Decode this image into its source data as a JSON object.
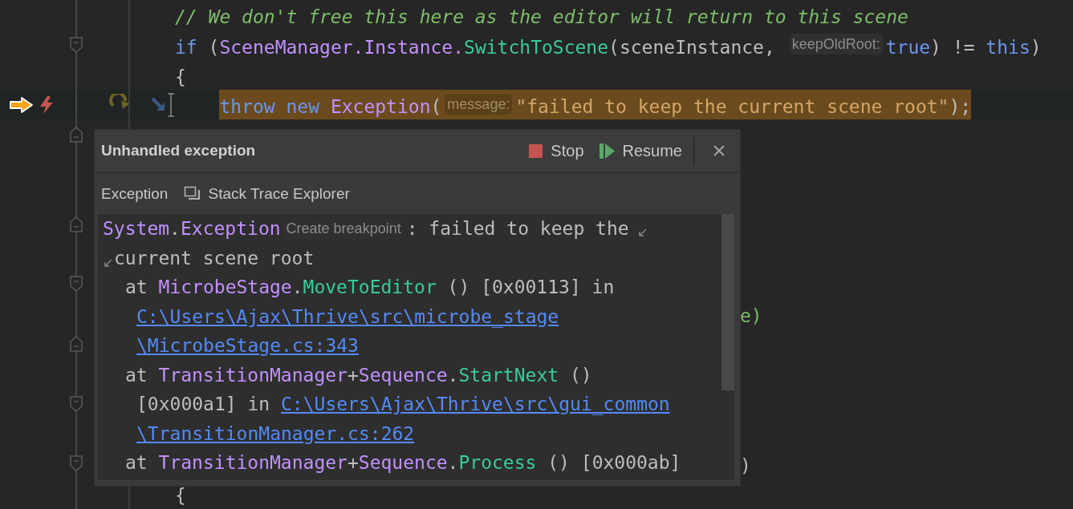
{
  "editor": {
    "lines": [
      {
        "kind": "plain",
        "tokens": [
          {
            "kind": "comment",
            "text": "// We don't free this here as the editor will return to this scene"
          }
        ]
      },
      {
        "kind": "fold-start",
        "tokens": [
          {
            "kind": "keyword",
            "text": "if"
          },
          {
            "kind": "plain",
            "text": " ("
          },
          {
            "kind": "type",
            "text": "SceneManager.Instance."
          },
          {
            "kind": "method",
            "text": "SwitchToScene"
          },
          {
            "kind": "plain",
            "text": "(sceneInstance, "
          },
          {
            "kind": "hint",
            "text": "keepOldRoot:"
          },
          {
            "kind": "keyword",
            "text": "true"
          },
          {
            "kind": "plain",
            "text": ") != "
          },
          {
            "kind": "keyword",
            "text": "this"
          },
          {
            "kind": "plain",
            "text": ")"
          }
        ]
      },
      {
        "kind": "plain",
        "tokens": [
          {
            "kind": "plain",
            "text": "{"
          }
        ],
        "children": [
          {
            "current": true,
            "tokens": [
              {
                "kind": "keyword",
                "text": "throw new "
              },
              {
                "kind": "type",
                "text": "Exception"
              },
              {
                "kind": "plain",
                "text": "("
              },
              {
                "kind": "hint",
                "text": "message:"
              },
              {
                "kind": "string",
                "text": "\"failed to keep the current scene root\""
              },
              {
                "kind": "plain",
                "text": ");"
              }
            ]
          }
        ]
      },
      {
        "kind": "fold-end"
      },
      {
        "kind": "plain"
      },
      {
        "kind": "plain"
      },
      {
        "kind": "fold-end"
      },
      {
        "kind": "plain"
      },
      {
        "kind": "fold-start"
      },
      {
        "kind": "plain",
        "tail": [
          {
            "kind": "tail",
            "text": "e)"
          }
        ]
      },
      {
        "kind": "fold-end"
      },
      {
        "kind": "plain"
      },
      {
        "kind": "fold-start"
      },
      {
        "kind": "plain"
      },
      {
        "kind": "fold-start",
        "tail": [
          {
            "kind": "plain",
            "text": ")"
          }
        ]
      },
      {
        "kind": "plain",
        "tokens": [
          {
            "kind": "plain",
            "text": "{"
          }
        ]
      }
    ]
  },
  "popup": {
    "title": "Unhandled exception",
    "actions": [
      {
        "kind": "stop",
        "label": "Stop"
      },
      {
        "kind": "resume",
        "label": "Resume"
      }
    ],
    "tabs": [
      {
        "kind": "plain",
        "label": "Exception"
      },
      {
        "kind": "explorer",
        "label": "Stack Trace Explorer"
      }
    ],
    "trace": [
      {
        "kind": "message",
        "tokens": [
          {
            "kind": "type",
            "text": "System"
          },
          {
            "kind": "plain",
            "text": "."
          },
          {
            "kind": "type",
            "text": "Exception"
          },
          {
            "kind": "hint",
            "text": "Create breakpoint"
          },
          {
            "kind": "plain",
            "text": ": failed to keep the"
          }
        ]
      },
      {
        "kind": "wrapped",
        "tokens": [
          {
            "kind": "plain",
            "text": "current scene root"
          }
        ]
      },
      {
        "kind": "frame",
        "tokens": [
          {
            "kind": "plain",
            "text": "at "
          },
          {
            "kind": "type",
            "text": "MicrobeStage"
          },
          {
            "kind": "plain",
            "text": "."
          },
          {
            "kind": "method",
            "text": "MoveToEditor"
          },
          {
            "kind": "plain",
            "text": " () [0x00113] in"
          }
        ]
      },
      {
        "kind": "continuation",
        "tokens": [
          {
            "kind": "link",
            "text": "C:\\Users\\Ajax\\Thrive\\src\\microbe_stage"
          }
        ]
      },
      {
        "kind": "continuation",
        "tokens": [
          {
            "kind": "link",
            "text": "\\MicrobeStage.cs:343"
          }
        ]
      },
      {
        "kind": "frame",
        "tokens": [
          {
            "kind": "plain",
            "text": "at "
          },
          {
            "kind": "type",
            "text": "TransitionManager"
          },
          {
            "kind": "plain",
            "text": "+"
          },
          {
            "kind": "type",
            "text": "Sequence"
          },
          {
            "kind": "plain",
            "text": "."
          },
          {
            "kind": "method",
            "text": "StartNext"
          },
          {
            "kind": "plain",
            "text": " ()"
          }
        ]
      },
      {
        "kind": "continuation",
        "tokens": [
          {
            "kind": "plain",
            "text": "[0x000a1] in "
          },
          {
            "kind": "link",
            "text": "C:\\Users\\Ajax\\Thrive\\src\\gui_common"
          }
        ]
      },
      {
        "kind": "continuation",
        "tokens": [
          {
            "kind": "link",
            "text": "\\TransitionManager.cs:262"
          }
        ]
      },
      {
        "kind": "frame",
        "tokens": [
          {
            "kind": "plain",
            "text": "at "
          },
          {
            "kind": "type",
            "text": "TransitionManager"
          },
          {
            "kind": "plain",
            "text": "+"
          },
          {
            "kind": "type",
            "text": "Sequence"
          },
          {
            "kind": "plain",
            "text": "."
          },
          {
            "kind": "method",
            "text": "Process"
          },
          {
            "kind": "plain",
            "text": " () [0x000ab]"
          }
        ]
      }
    ]
  }
}
